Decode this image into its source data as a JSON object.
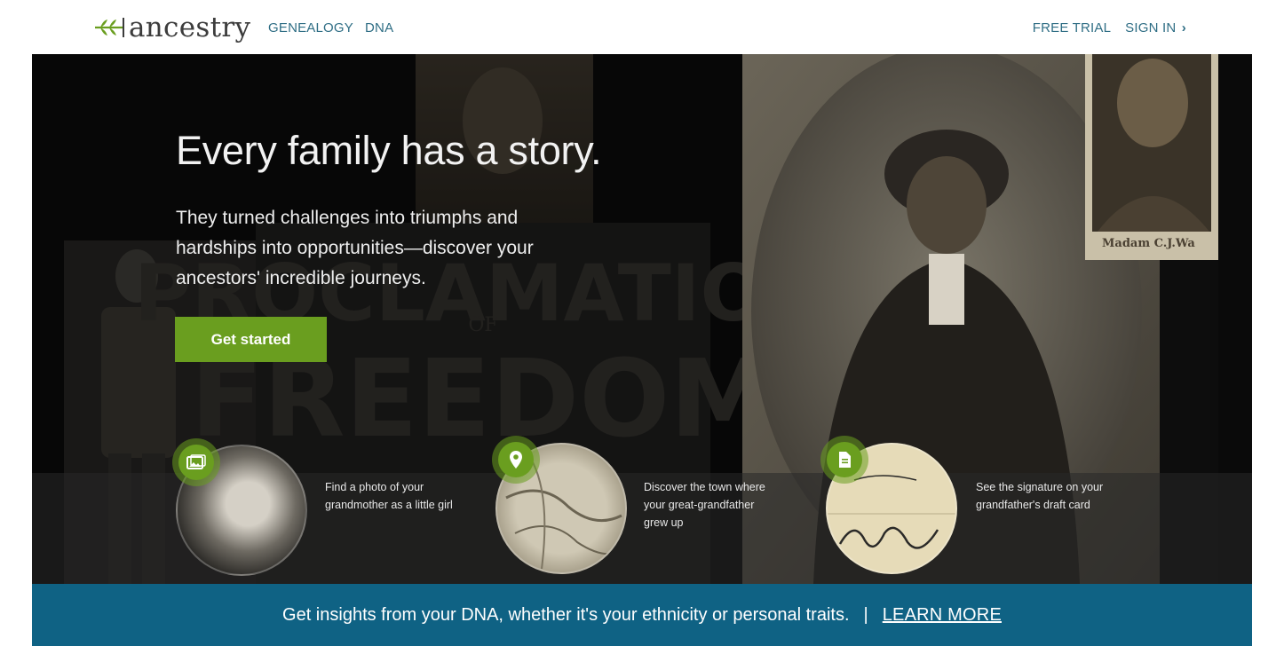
{
  "nav": {
    "brand": "ancestry",
    "left_links": [
      "GENEALOGY",
      "DNA"
    ],
    "free_trial": "FREE TRIAL",
    "sign_in": "SIGN IN",
    "sign_in_chevron": "›"
  },
  "hero": {
    "headline": "Every family has a story.",
    "subtext": "They turned challenges into triumphs and hardships into opportunities—discover your ancestors' incredible journeys.",
    "cta_label": "Get started",
    "background_words": {
      "proclamation": "PROCLAMATION",
      "of": "OF",
      "freedom": "FREEDOM"
    },
    "stamp_caption": "Madam C.J.Wa",
    "features": [
      {
        "icon": "photo-icon",
        "text": "Find a photo of your grandmother as a little girl"
      },
      {
        "icon": "map-pin-icon",
        "text": "Discover the town where your great-grandfather grew up"
      },
      {
        "icon": "document-icon",
        "text": "See the signature on your grandfather's draft card"
      }
    ]
  },
  "dna_banner": {
    "text": "Get insights from your DNA, whether it's your ethnicity or personal traits.",
    "separator": "|",
    "link": "LEARN MORE"
  },
  "colors": {
    "brand_green": "#6a9e1f",
    "nav_blue": "#2f6e85",
    "banner_blue": "#0f6284",
    "hero_bg": "#0d0d0d"
  }
}
